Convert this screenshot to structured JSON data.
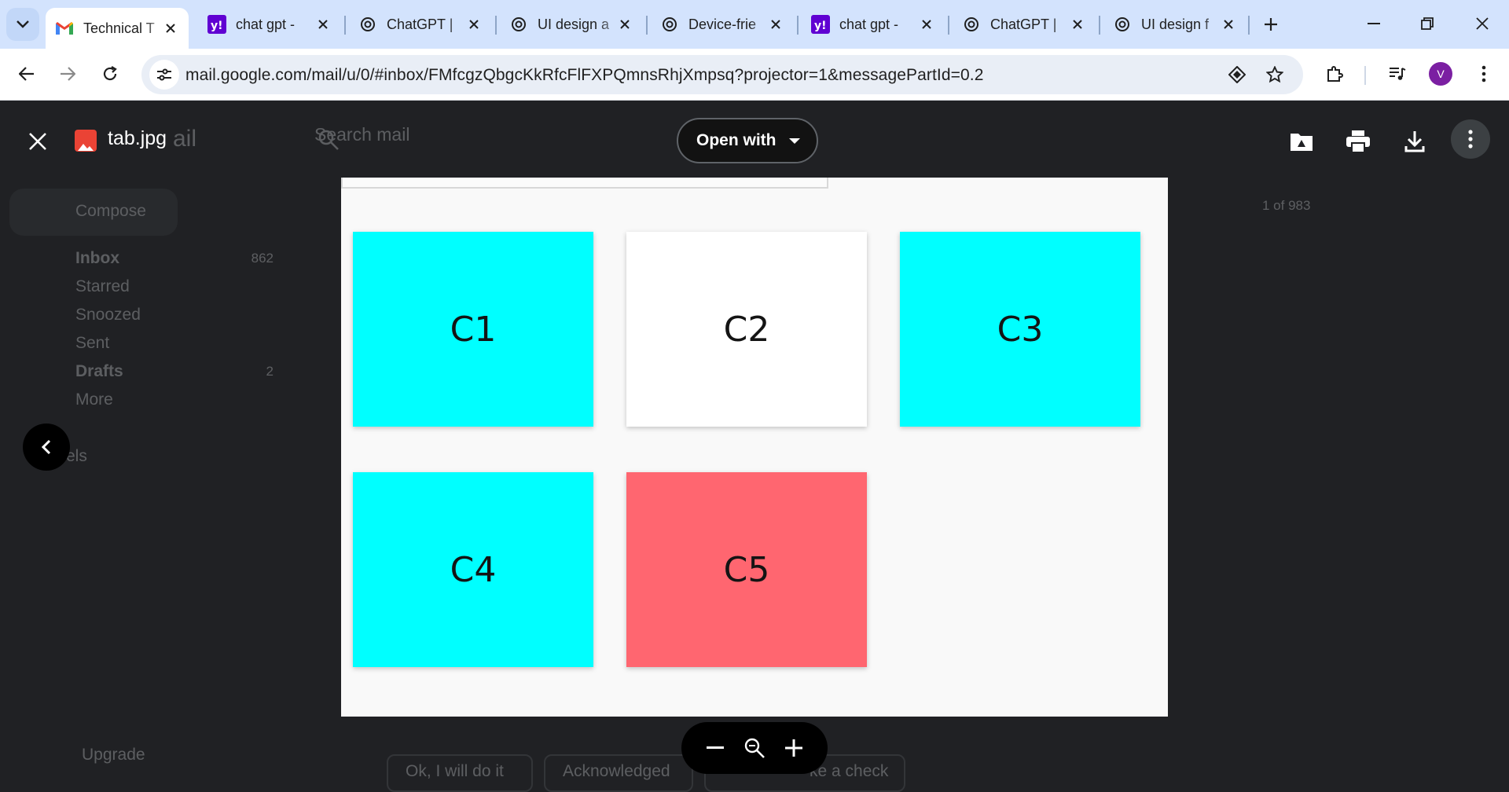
{
  "browser": {
    "tabs": [
      {
        "title": "Technical T",
        "icon": "gmail-icon",
        "active": true
      },
      {
        "title": "chat gpt - ",
        "icon": "yahoo-icon",
        "active": false
      },
      {
        "title": "ChatGPT | ",
        "icon": "openai-icon",
        "active": false
      },
      {
        "title": "UI design a",
        "icon": "openai-icon",
        "active": false
      },
      {
        "title": "Device-frie",
        "icon": "openai-icon",
        "active": false
      },
      {
        "title": "chat gpt - ",
        "icon": "yahoo-icon",
        "active": false
      },
      {
        "title": "ChatGPT | ",
        "icon": "openai-icon",
        "active": false
      },
      {
        "title": "UI design f",
        "icon": "openai-icon",
        "active": false
      }
    ],
    "url": "mail.google.com/mail/u/0/#inbox/FMfcgzQbgcKkRfcFlFXPQmnsRhjXmpsq?projector=1&messagePartId=0.2",
    "profile_initial": "V",
    "profile_color": "#7b1fa2"
  },
  "gmail": {
    "search_placeholder": "Search mail",
    "compose": "Compose",
    "logo_text": "ail",
    "nav": [
      {
        "label": "Inbox",
        "count": "862"
      },
      {
        "label": "Starred",
        "count": ""
      },
      {
        "label": "Snoozed",
        "count": ""
      },
      {
        "label": "Sent",
        "count": ""
      },
      {
        "label": "Drafts",
        "count": "2"
      },
      {
        "label": "More",
        "count": ""
      }
    ],
    "labels_heading": "els",
    "upgrade": "Upgrade",
    "pagination": "1 of 983",
    "chips": [
      "Ok, I will do it",
      "Acknowledged",
      "ke a check"
    ]
  },
  "viewer": {
    "file_name": "tab.jpg",
    "open_with": "Open with"
  },
  "image": {
    "cards": [
      {
        "label": "C1",
        "color": "#00ffff"
      },
      {
        "label": "C2",
        "color": "#ffffff"
      },
      {
        "label": "C3",
        "color": "#00ffff"
      },
      {
        "label": "C4",
        "color": "#00ffff"
      },
      {
        "label": "C5",
        "color": "#ff6670"
      }
    ]
  }
}
